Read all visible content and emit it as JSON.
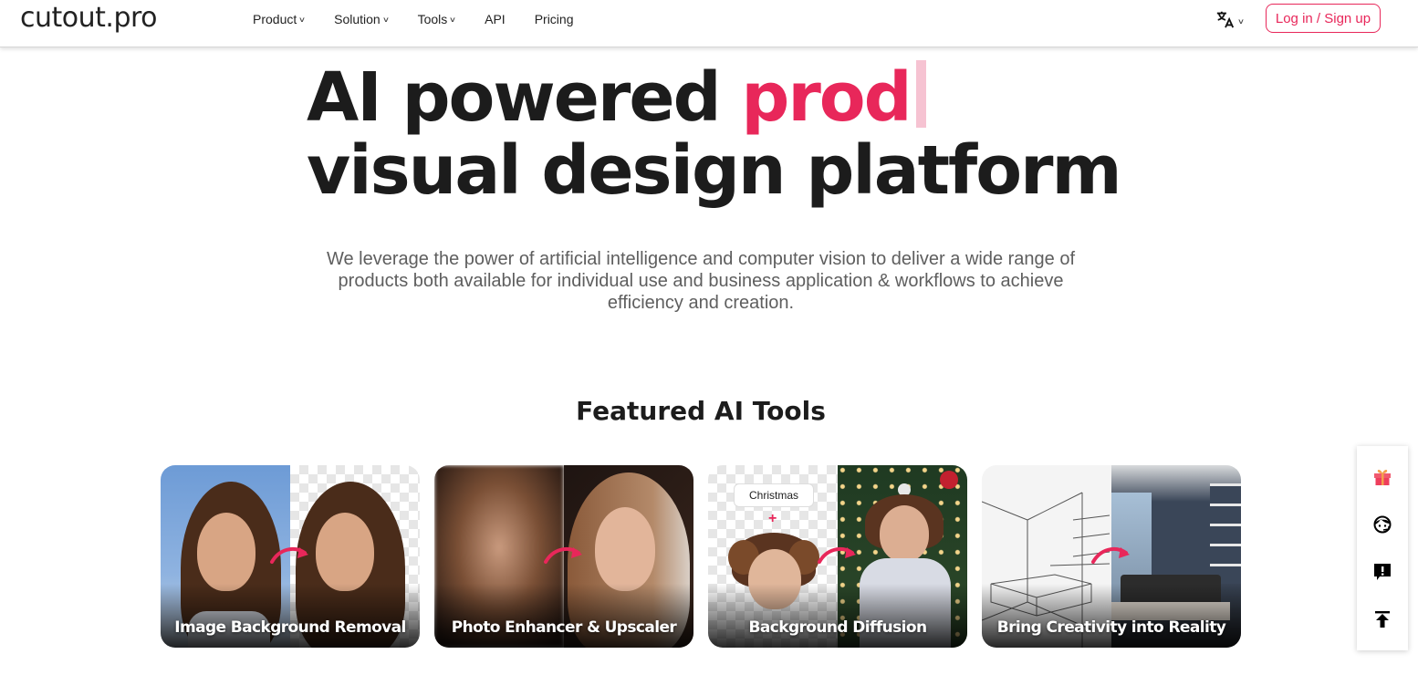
{
  "header": {
    "logo": "cutout.pro",
    "nav": [
      {
        "label": "Product",
        "has_dropdown": true
      },
      {
        "label": "Solution",
        "has_dropdown": true
      },
      {
        "label": "Tools",
        "has_dropdown": true
      },
      {
        "label": "API",
        "has_dropdown": false
      },
      {
        "label": "Pricing",
        "has_dropdown": false
      }
    ],
    "language_icon": "translate-icon",
    "login_label": "Log in / Sign up"
  },
  "hero": {
    "title_line1_prefix": "AI powered ",
    "title_line1_accent": "prod",
    "title_line2": "visual design platform",
    "subtitle": "We leverage the power of artificial intelligence and computer vision to deliver a wide range of products both available for individual use and business application & workflows to achieve efficiency and creation."
  },
  "featured": {
    "title": "Featured AI Tools",
    "cards": [
      {
        "label": "Image Background Removal"
      },
      {
        "label": "Photo Enhancer & Upscaler"
      },
      {
        "label": "Background Diffusion",
        "chip": "Christmas",
        "plus": "+"
      },
      {
        "label": "Bring Creativity into Reality"
      }
    ]
  },
  "float_bar": {
    "items": [
      {
        "icon": "gift-icon"
      },
      {
        "icon": "customer-support-icon"
      },
      {
        "icon": "feedback-icon"
      },
      {
        "icon": "back-to-top-icon"
      }
    ]
  },
  "colors": {
    "accent": "#e8275a",
    "caret": "#f6c3d2",
    "text": "#1c1c1c",
    "subtext": "#5e5e5e"
  }
}
